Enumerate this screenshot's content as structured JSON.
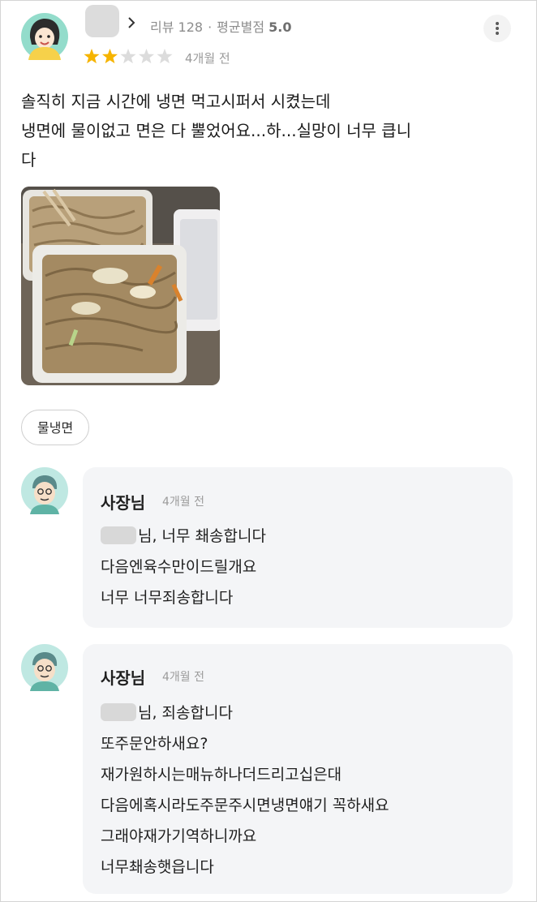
{
  "review": {
    "meta": {
      "review_label": "리뷰 128",
      "avg_label": "평균별점",
      "avg_value": "5.0"
    },
    "rating": 2,
    "rating_max": 5,
    "time": "4개월 전",
    "text_lines": [
      "솔직히 지금 시간에 냉면 먹고시퍼서 시켰는데",
      "냉면에 물이없고 면은 다 뿔었어요...하...실망이 너무 큽니",
      "다"
    ],
    "tag": "물냉면"
  },
  "replies": [
    {
      "owner_name": "사장님",
      "time": "4개월 전",
      "lines": [
        "님, 너무 쵀송합니다",
        "다음엔육수만이드릴개요",
        "너무 너무죄송합니다"
      ]
    },
    {
      "owner_name": "사장님",
      "time": "4개월 전",
      "lines": [
        "님, 죄송합니다",
        "또주문안하새요?",
        "재가원하시는매뉴하나더드리고십은대",
        "다음에혹시라도주문주시면냉면얘기 꼭하새요",
        "그래야재가기역하니까요",
        "너무쵀송햇읍니다"
      ]
    }
  ],
  "colors": {
    "star_filled": "#f6b400",
    "star_empty": "#dcdcdc",
    "reply_bg": "#f4f5f7",
    "meta_text": "#8d8d8d"
  },
  "icons": [
    "user-avatar-icon",
    "chevron-right-icon",
    "more-vertical-icon",
    "owner-avatar-icon",
    "star-icon"
  ]
}
